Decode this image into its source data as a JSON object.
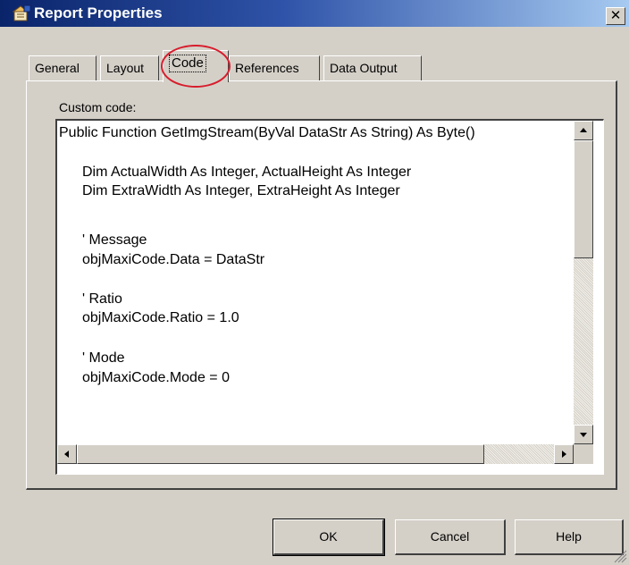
{
  "window": {
    "title": "Report Properties",
    "close_glyph": "✕"
  },
  "tabs": [
    {
      "label": "General"
    },
    {
      "label": "Layout"
    },
    {
      "label": "Code"
    },
    {
      "label": "References"
    },
    {
      "label": "Data Output"
    }
  ],
  "active_tab": "Code",
  "code": {
    "label": "Custom code:",
    "lines": [
      "Public Function GetImgStream(ByVal DataStr As String) As Byte()",
      "Dim ActualWidth As Integer, ActualHeight As Integer",
      "Dim ExtraWidth As Integer, ExtraHeight As Integer",
      "' Message",
      "objMaxiCode.Data = DataStr",
      "' Ratio",
      "objMaxiCode.Ratio = 1.0",
      "' Mode",
      "objMaxiCode.Mode = 0"
    ]
  },
  "buttons": {
    "ok": "OK",
    "cancel": "Cancel",
    "help": "Help"
  },
  "colors": {
    "titlebar_start": "#0a246a",
    "titlebar_end": "#a6caf0",
    "highlight": "#d81c2c",
    "dialog_bg": "#d4d0c8"
  },
  "icons": [
    "window-icon",
    "close-icon",
    "scroll-up-icon",
    "scroll-down-icon",
    "scroll-left-icon",
    "scroll-right-icon",
    "size-grip-icon"
  ]
}
